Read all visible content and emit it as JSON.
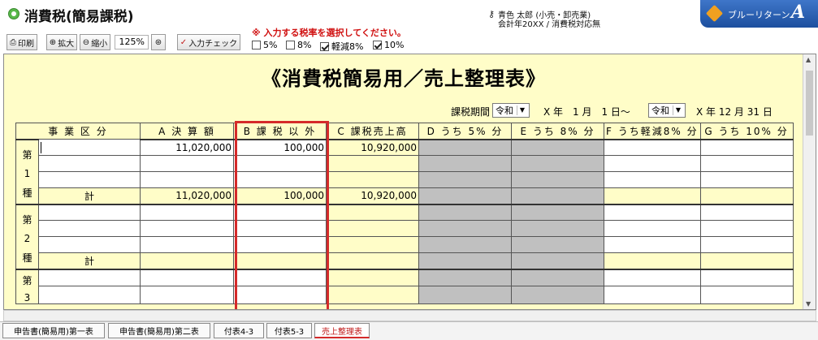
{
  "window": {
    "title": "消費税(簡易課税)"
  },
  "user": {
    "line1": "青色 太郎 (小売・卸売業)",
    "line2": "会計年20XX / 消費税対応無"
  },
  "brand": {
    "name": "ブルーリターン",
    "letter": "A"
  },
  "toolbar": {
    "print_label": "印刷",
    "zoom_in_label": "拡大",
    "zoom_out_label": "縮小",
    "zoom_value": "125%",
    "check_label": "入力チェック"
  },
  "rates": {
    "warning": "※ 入力する税率を選択してください。",
    "options": [
      {
        "label": "5%",
        "checked": false
      },
      {
        "label": "8%",
        "checked": false
      },
      {
        "label": "軽減8%",
        "checked": true
      },
      {
        "label": "10%",
        "checked": true
      }
    ]
  },
  "sheet": {
    "title": "《消費税簡易用／売上整理表》",
    "period": {
      "label": "課税期間",
      "era_start": "令和",
      "start_rest": "X 年　1 月　1 日～",
      "era_end": "令和",
      "end_rest": "X 年 12 月 31 日"
    },
    "headers": [
      "事 業 区 分",
      "A 決 算 額",
      "B 課 税 以 外",
      "C 課税売上高",
      "D うち 5% 分",
      "E うち 8% 分",
      "F うち軽減8% 分",
      "G うち 10% 分"
    ],
    "groups": [
      {
        "side": [
          "第",
          "1",
          "種"
        ],
        "rows": [
          {
            "a": "11,020,000",
            "b": "100,000",
            "c": "10,920,000"
          },
          {
            "a": "",
            "b": "",
            "c": ""
          },
          {
            "a": "",
            "b": "",
            "c": ""
          }
        ],
        "total": {
          "label": "計",
          "a": "11,020,000",
          "b": "100,000",
          "c": "10,920,000"
        }
      },
      {
        "side": [
          "第",
          "2",
          "種"
        ],
        "rows": [
          {
            "a": "",
            "b": "",
            "c": ""
          },
          {
            "a": "",
            "b": "",
            "c": ""
          },
          {
            "a": "",
            "b": "",
            "c": ""
          }
        ],
        "total": {
          "label": "計",
          "a": "",
          "b": "",
          "c": ""
        }
      },
      {
        "side": [
          "第",
          "3",
          ""
        ],
        "rows": [
          {
            "a": "",
            "b": "",
            "c": ""
          },
          {
            "a": "",
            "b": "",
            "c": ""
          }
        ]
      }
    ]
  },
  "tabs": [
    {
      "label": "申告書(簡易用)第一表",
      "active": false
    },
    {
      "label": "申告書(簡易用)第二表",
      "active": false
    },
    {
      "label": "付表4-3",
      "active": false
    },
    {
      "label": "付表5-3",
      "active": false
    },
    {
      "label": "売上整理表",
      "active": true
    }
  ],
  "colors": {
    "sheet_bg": "#fffdc8",
    "highlight": "#d52a2a",
    "disabled": "#c0c0c0",
    "brand": "#1d4f9e"
  }
}
